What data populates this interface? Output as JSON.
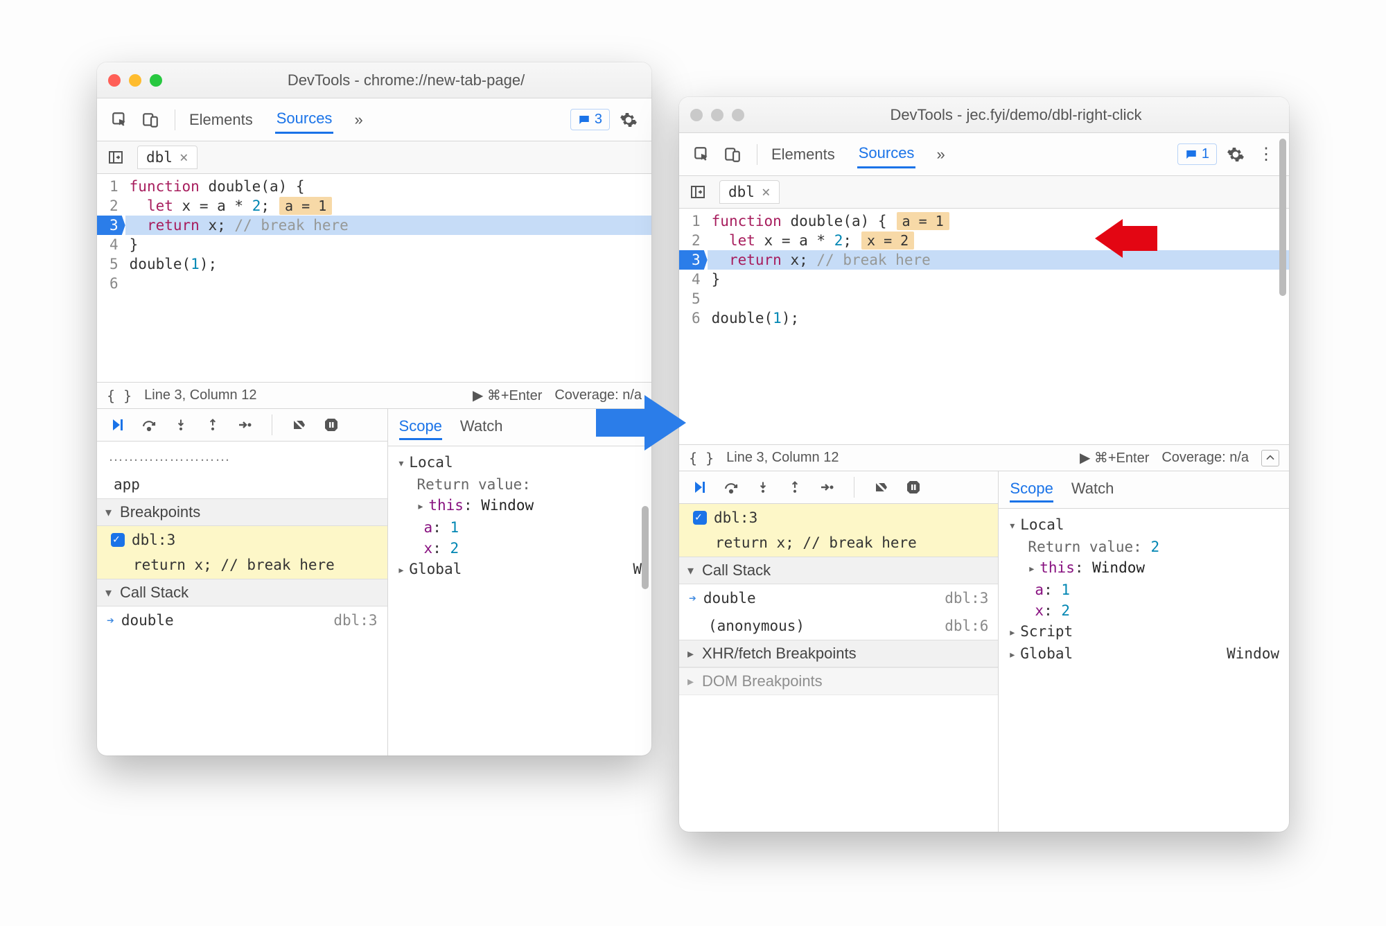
{
  "leftWindow": {
    "title": "DevTools - chrome://new-tab-page/",
    "tabs": {
      "elements": "Elements",
      "sources": "Sources"
    },
    "chipCount": "3",
    "fileTab": "dbl",
    "code": {
      "l1a": "function",
      "l1b": " double(a) {",
      "l2a": "let",
      "l2b": " x = a * ",
      "l2c": "2",
      "l2d": ";",
      "l2badge": "a = 1",
      "l3a": "return",
      "l3b": " x; ",
      "l3c": "// break here",
      "l4": "}",
      "l5": "",
      "l6a": "double(",
      "l6b": "1",
      "l6c": ");"
    },
    "status": {
      "pos": "Line 3, Column 12",
      "enter": "⌘+Enter",
      "cov": "Coverage: n/a"
    },
    "sidebar": {
      "app": "app",
      "breakpoints": "Breakpoints",
      "bpName": "dbl:3",
      "bpCode": "return x; // break here",
      "callstack": "Call Stack",
      "csFunc": "double",
      "csLoc": "dbl:3"
    },
    "scope": {
      "tabScope": "Scope",
      "tabWatch": "Watch",
      "local": "Local",
      "retLabel": "Return value:",
      "thisLabel": "this",
      "thisVal": "Window",
      "aLabel": "a",
      "aVal": "1",
      "xLabel": "x",
      "xVal": "2",
      "global": "Global",
      "globalRight": "W"
    }
  },
  "rightWindow": {
    "title": "DevTools - jec.fyi/demo/dbl-right-click",
    "tabs": {
      "elements": "Elements",
      "sources": "Sources"
    },
    "chipCount": "1",
    "fileTab": "dbl",
    "code": {
      "l1a": "function",
      "l1b": " double(a) {",
      "l1badge": "a = 1",
      "l2a": "let",
      "l2b": " x = a * ",
      "l2c": "2",
      "l2d": ";",
      "l2badge": "x = 2",
      "l3a": "return",
      "l3b": " x; ",
      "l3c": "// break here",
      "l4": "}",
      "l5": "",
      "l6a": "double(",
      "l6b": "1",
      "l6c": ");"
    },
    "status": {
      "pos": "Line 3, Column 12",
      "enter": "⌘+Enter",
      "cov": "Coverage: n/a"
    },
    "sidebar": {
      "bpName": "dbl:3",
      "bpCode": "return x; // break here",
      "callstack": "Call Stack",
      "cs1": "double",
      "cs1loc": "dbl:3",
      "cs2": "(anonymous)",
      "cs2loc": "dbl:6",
      "xhr": "XHR/fetch Breakpoints",
      "dom": "DOM Breakpoints"
    },
    "scope": {
      "tabScope": "Scope",
      "tabWatch": "Watch",
      "local": "Local",
      "retLabel": "Return value:",
      "retVal": "2",
      "thisLabel": "this",
      "thisVal": "Window",
      "aLabel": "a",
      "aVal": "1",
      "xLabel": "x",
      "xVal": "2",
      "script": "Script",
      "global": "Global",
      "globalRight": "Window"
    }
  }
}
